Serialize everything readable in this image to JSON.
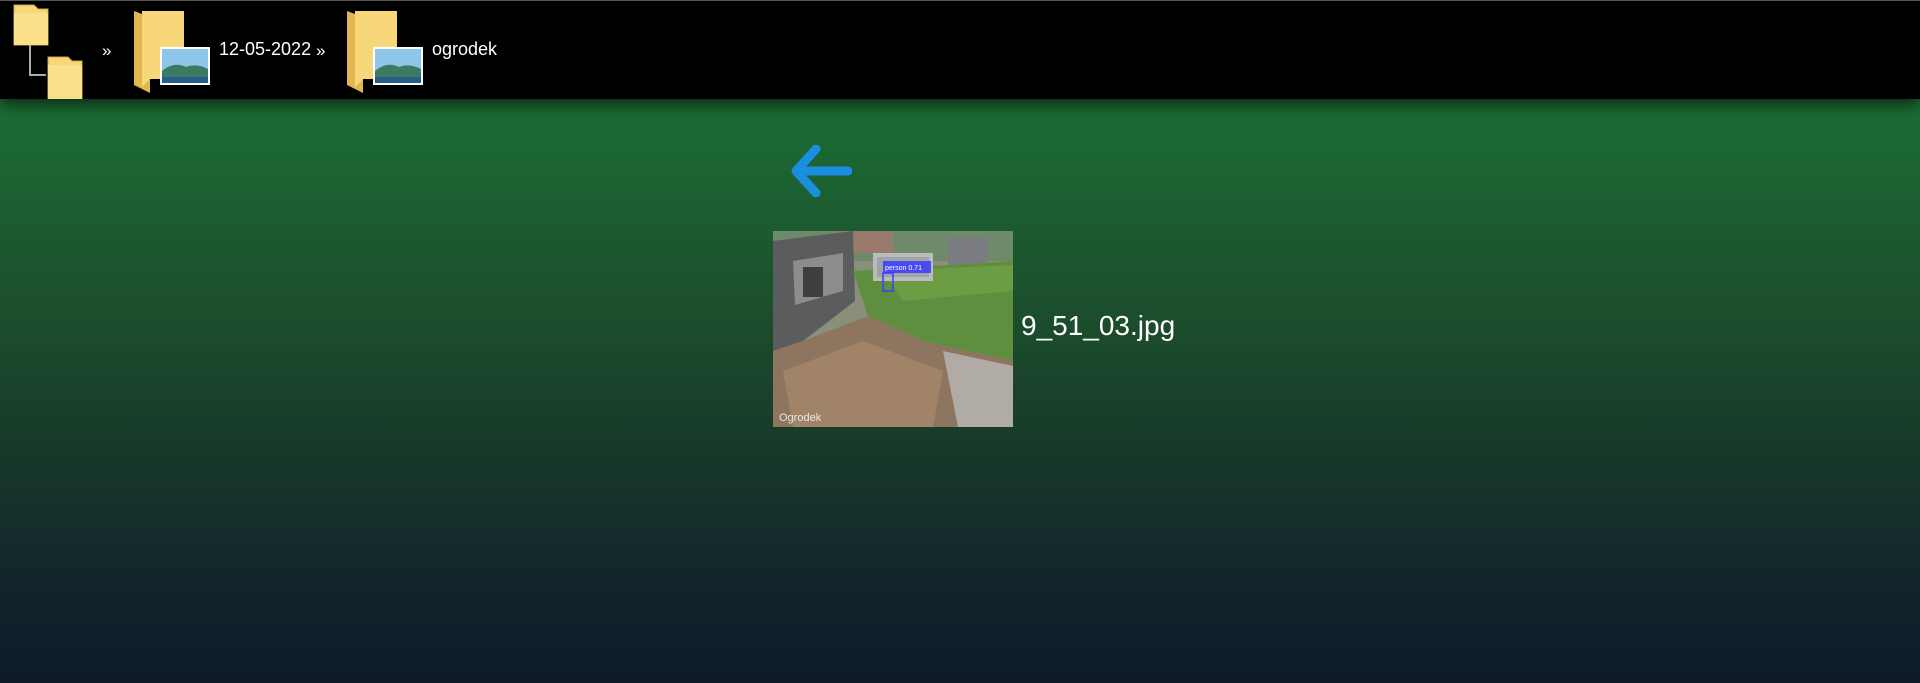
{
  "breadcrumb": {
    "separator": "»",
    "items": [
      {
        "label": "",
        "icon": "folder-tree-icon"
      },
      {
        "label": "12-05-2022",
        "icon": "folder-image-icon"
      },
      {
        "label": "ogrodek",
        "icon": "folder-image-icon"
      }
    ]
  },
  "navigation": {
    "back_icon": "back-arrow-icon",
    "back_color": "#1a8fe0"
  },
  "gallery": {
    "items": [
      {
        "file_name": "9_51_03.jpg",
        "thumbnail": {
          "camera_label": "Ogrodek",
          "detection_label": "person 0.71",
          "detection_color": "#3b3bff"
        }
      }
    ]
  },
  "colors": {
    "topbar": "#000000",
    "folder": "#f7d77a",
    "text": "#ffffff"
  }
}
